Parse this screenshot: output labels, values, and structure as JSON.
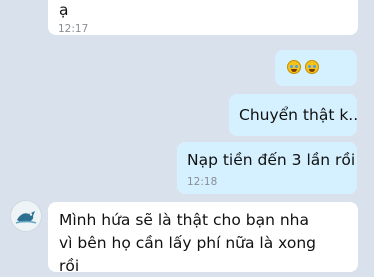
{
  "messages": [
    {
      "direction": "incoming",
      "text": "ạ",
      "time": "12:17"
    },
    {
      "direction": "outgoing",
      "emoji": [
        "rolling-on-floor-laughing-emoji",
        "rolling-on-floor-laughing-emoji"
      ]
    },
    {
      "direction": "outgoing",
      "text": "Chuyển thật k.."
    },
    {
      "direction": "outgoing",
      "text": "Nạp tiền đến 3 lần rồi",
      "time": "12:18"
    },
    {
      "direction": "incoming",
      "lines": [
        "Mình hứa sẽ là thật cho bạn nha",
        "vì bên họ cần lấy phí nữa là xong",
        "rồi"
      ]
    }
  ],
  "colors": {
    "background": "#d9e1ec",
    "incoming_bubble": "#ffffff",
    "outgoing_bubble": "#d5f0ff",
    "timestamp": "#8a8f96"
  }
}
